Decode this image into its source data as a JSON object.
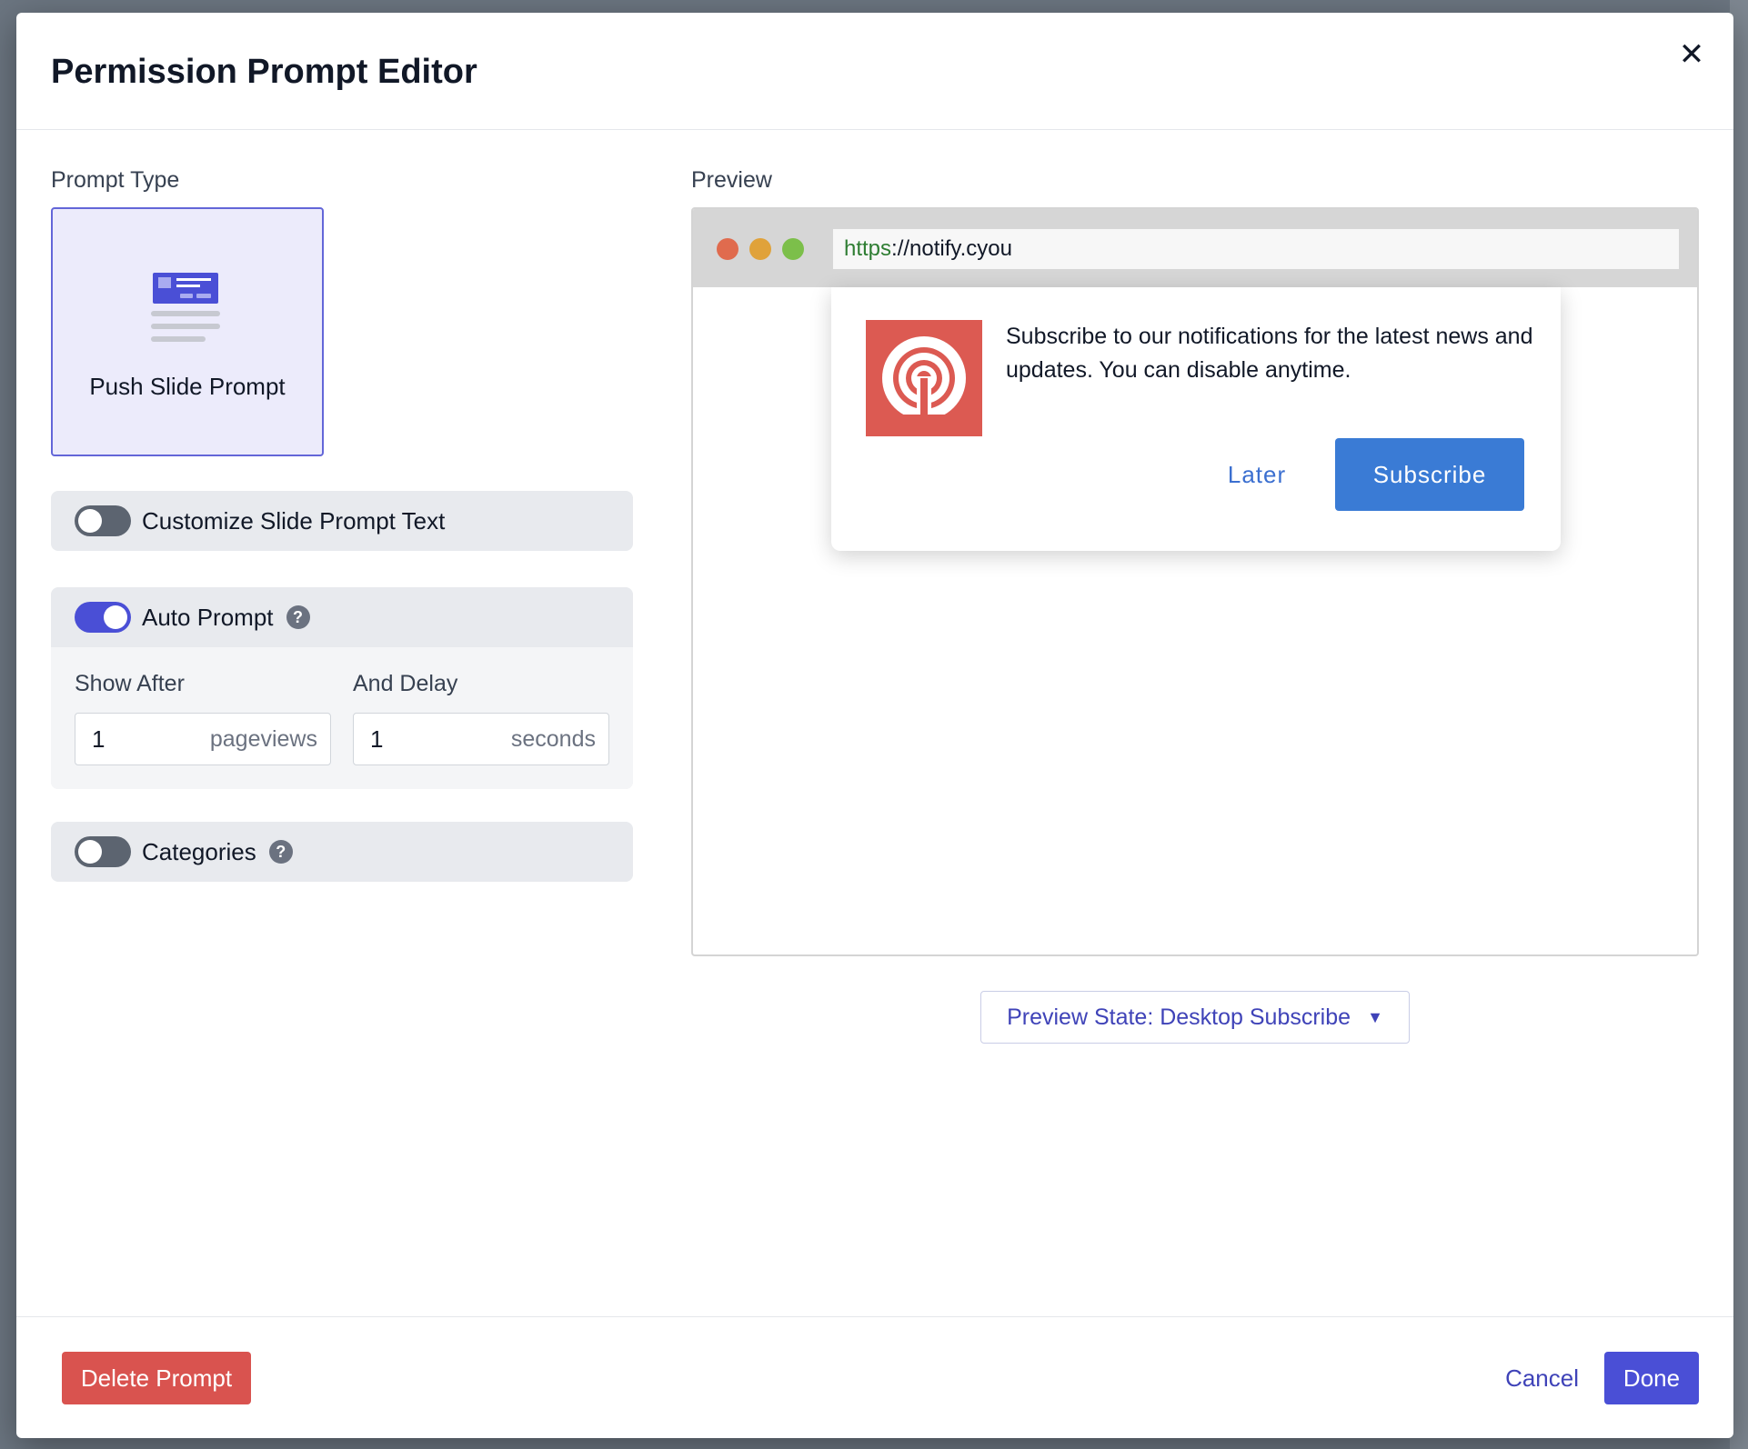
{
  "modal": {
    "title": "Permission Prompt Editor",
    "close_icon": "close-icon"
  },
  "prompt_type": {
    "label": "Prompt Type",
    "selected_card": "Push Slide Prompt",
    "card_icon": "slide-prompt-icon"
  },
  "customize_text": {
    "label": "Customize Slide Prompt Text",
    "enabled": false
  },
  "auto_prompt": {
    "label": "Auto Prompt",
    "enabled": true,
    "show_after_label": "Show After",
    "show_after_value": "1",
    "show_after_unit": "pageviews",
    "delay_label": "And Delay",
    "delay_value": "1",
    "delay_unit": "seconds"
  },
  "categories": {
    "label": "Categories",
    "enabled": false
  },
  "preview": {
    "label": "Preview",
    "url_scheme": "https",
    "url_rest": "://notify.cyou",
    "message": "Subscribe to our notifications for the latest news and updates. You can disable anytime.",
    "later_label": "Later",
    "subscribe_label": "Subscribe",
    "state_label": "Preview State: Desktop Subscribe",
    "colors": {
      "icon_bg": "#dc5a52",
      "subscribe_bg": "#3a7bd5"
    }
  },
  "footer": {
    "delete_label": "Delete Prompt",
    "cancel_label": "Cancel",
    "done_label": "Done"
  },
  "colors": {
    "accent": "#4a4fd6",
    "danger": "#d9534f"
  }
}
